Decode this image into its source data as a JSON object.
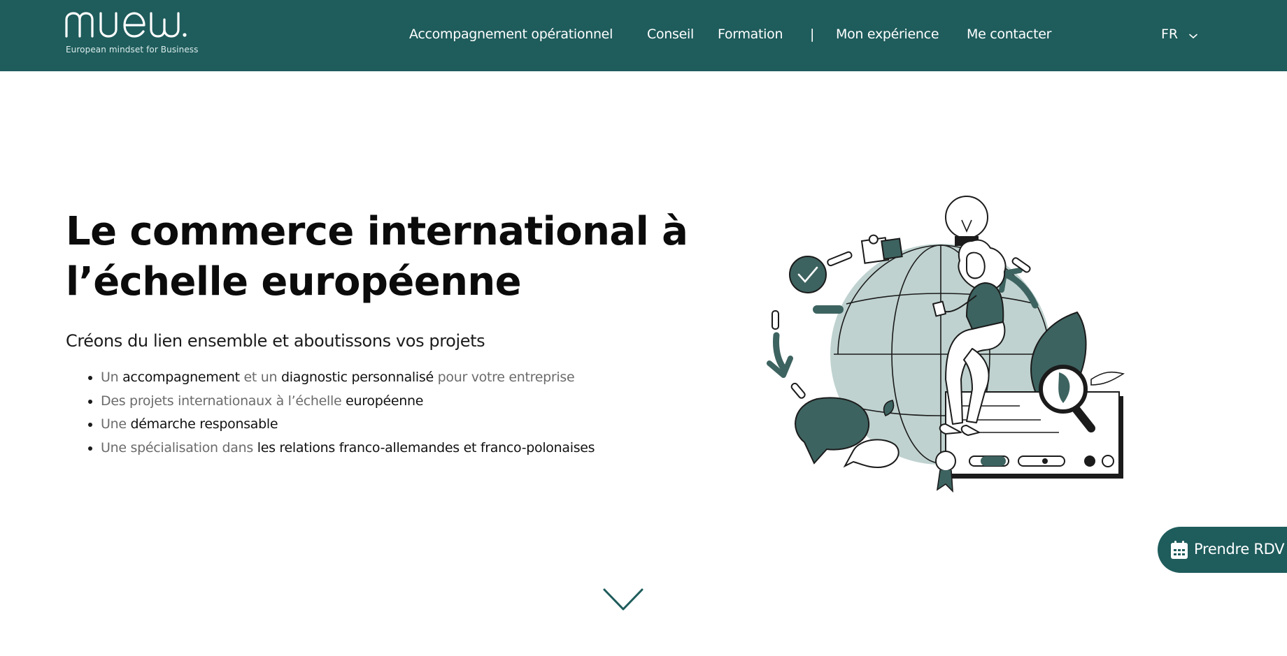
{
  "header": {
    "background": "#1f5c5c",
    "logo": {
      "wordmark": "muew.",
      "tagline": "European mindset for Business"
    },
    "nav": {
      "items": [
        {
          "label": "Accompagnement opérationnel"
        },
        {
          "label": "Conseil"
        },
        {
          "label": "Formation"
        },
        {
          "label": "Mon expérience"
        },
        {
          "label": "Me contacter"
        }
      ],
      "separator": "|"
    },
    "language": {
      "selected": "FR",
      "icon": "chevron-down-icon"
    }
  },
  "hero": {
    "title_line1": "Le commerce international à",
    "title_line2": "l’échelle européenne",
    "subtitle": "Créons du lien ensemble et aboutissons vos projets",
    "bullets": [
      {
        "parts": [
          {
            "text": "Un ",
            "strong": false
          },
          {
            "text": "accompagnement",
            "strong": true
          },
          {
            "text": " et un ",
            "strong": false
          },
          {
            "text": "diagnostic personnalisé",
            "strong": true
          },
          {
            "text": " pour votre entreprise",
            "strong": false
          }
        ]
      },
      {
        "parts": [
          {
            "text": "Des projets internationaux à l’échelle ",
            "strong": false
          },
          {
            "text": "européenne",
            "strong": true
          }
        ]
      },
      {
        "parts": [
          {
            "text": "Une ",
            "strong": false
          },
          {
            "text": "démarche responsable",
            "strong": true
          }
        ]
      },
      {
        "parts": [
          {
            "text": "Une spécialisation dans ",
            "strong": false
          },
          {
            "text": "les relations franco-allemandes et franco-polonaises",
            "strong": true
          }
        ]
      }
    ],
    "illustration": {
      "icon": "globe-woman-illustration"
    }
  },
  "floating_button": {
    "label": "Prendre RDV",
    "icon": "calendar-icon",
    "background": "#1f5c5c"
  },
  "scroll_indicator": {
    "icon": "chevron-down-icon",
    "color": "#1f5c5c"
  }
}
